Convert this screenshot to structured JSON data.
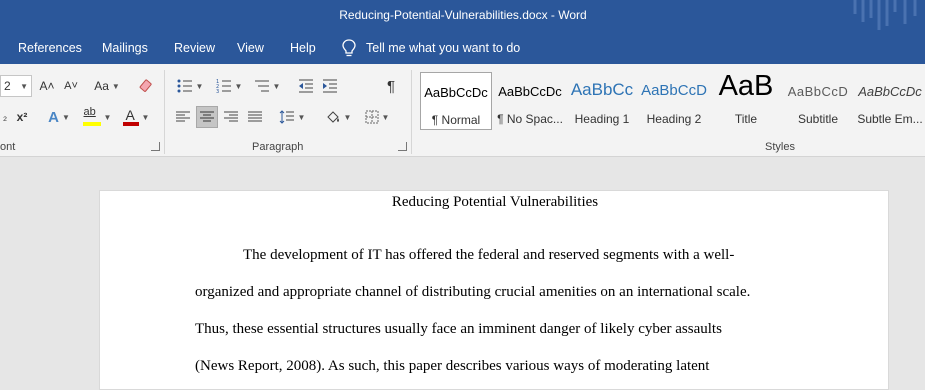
{
  "window": {
    "title": "Reducing-Potential-Vulnerabilities.docx  -  Word"
  },
  "menu": {
    "items": [
      "References",
      "Mailings",
      "Review",
      "View",
      "Help"
    ],
    "tell_me": "Tell me what you want to do"
  },
  "ribbon": {
    "font": {
      "label": "ont",
      "font_size": "2",
      "grow": "A˄",
      "shrink": "A˅",
      "change_case": "Aa",
      "subscript": "₂",
      "superscript": "x²",
      "text_effects": "A",
      "highlight": "ab",
      "font_color": "A"
    },
    "paragraph": {
      "label": "Paragraph",
      "pilcrow": "¶"
    },
    "styles": {
      "label": "Styles",
      "tiles": [
        {
          "sample": "AaBbCcDc",
          "name": "¶ Normal"
        },
        {
          "sample": "AaBbCcDc",
          "name": "¶ No Spac..."
        },
        {
          "sample": "AaBbCc",
          "name": "Heading 1"
        },
        {
          "sample": "AaBbCcD",
          "name": "Heading 2"
        },
        {
          "sample": "AaB",
          "name": "Title"
        },
        {
          "sample": "AaBbCcD",
          "name": "Subtitle"
        },
        {
          "sample": "AaBbCcDc",
          "name": "Subtle Em..."
        }
      ]
    }
  },
  "document": {
    "title": "Reducing Potential Vulnerabilities",
    "lines": [
      "The development of IT has offered the federal and reserved segments with a well-",
      "organized and appropriate channel of distributing crucial amenities on an international scale.",
      "Thus, these essential structures usually face an imminent danger of likely cyber assaults",
      "(News Report, 2008). As such, this paper describes various ways of moderating latent"
    ]
  },
  "colors": {
    "brand": "#2b579a",
    "ribbon": "#f3f3f3",
    "canvas": "#e6e6e6",
    "heading_blue": "#2e74b5",
    "font_red": "#c00000",
    "highlight_yellow": "#ffff00"
  }
}
